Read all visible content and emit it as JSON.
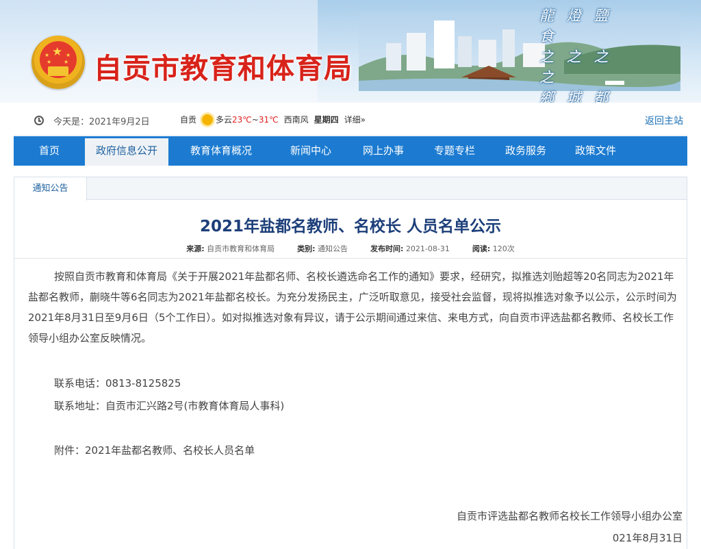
{
  "header": {
    "site_title": "自贡市教育和体育局",
    "calligraphy": [
      "龍 燈 鹽 食",
      "之 之 之 之",
      "鄉 城 都 府"
    ]
  },
  "infobar": {
    "today": "今天是：2021年9月2日",
    "city": "自贡",
    "weather": "多云",
    "temp_high": "23℃",
    "temp_sep": "~",
    "temp_low": "31℃",
    "wind": "西南风",
    "weekday": "星期四",
    "detail": "详细»",
    "home_link": "返回主站"
  },
  "nav": {
    "items": [
      "首页",
      "政府信息公开",
      "教育体育概况",
      "新闻中心",
      "网上办事",
      "专题专栏",
      "政务服务",
      "政策文件"
    ],
    "active_index": 1
  },
  "article": {
    "tab": "通知公告",
    "title": "2021年盐都名教师、名校长 人员名单公示",
    "meta": {
      "source_label": "来源:",
      "source": "自贡市教育和体育局",
      "category_label": "类别:",
      "category": "通知公告",
      "date_label": "发布时间:",
      "date": "2021-08-31",
      "views_label": "阅读:",
      "views": "120次"
    },
    "body": "按照自贡市教育和体育局《关于开展2021年盐都名师、名校长遴选命名工作的通知》要求，经研究，拟推选刘贻超等20名同志为2021年盐都名教师，蒯晓牛等6名同志为2021年盐都名校长。为充分发扬民主，广泛听取意见，接受社会监督，现将拟推选对象予以公示，公示时间为2021年8月31日至9月6日（5个工作日）。如对拟推选对象有异议，请于公示期间通过来信、来电方式，向自贡市评选盐都名教师、名校长工作领导小组办公室反映情况。",
    "phone": "联系电话：0813-8125825",
    "address": "联系地址：自贡市汇兴路2号(市教育体育局人事科)",
    "attachment": "附件：2021年盐都名教师、名校长人员名单",
    "signature": "自贡市评选盐都名教师名校长工作领导小组办公室",
    "sign_date": "021年8月31日"
  },
  "colors": {
    "brand_red": "#d8231a",
    "nav_blue": "#1c7bd1",
    "title_navy": "#1d3f7a"
  }
}
